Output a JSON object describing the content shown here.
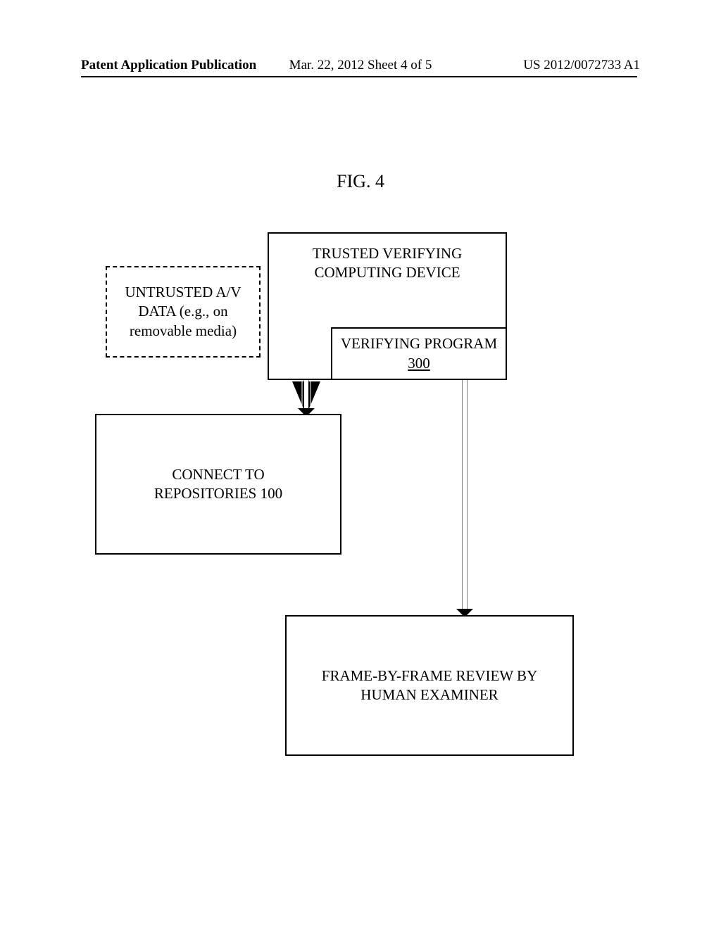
{
  "header": {
    "left": "Patent Application Publication",
    "center": "Mar. 22, 2012  Sheet 4 of 5",
    "right": "US 2012/0072733 A1"
  },
  "figure_label": "FIG. 4",
  "boxes": {
    "untrusted": {
      "line1": "UNTRUSTED A/V",
      "line2": "DATA (e.g., on",
      "line3": "removable media)"
    },
    "trusted": {
      "line1": "TRUSTED VERIFYING",
      "line2": "COMPUTING DEVICE"
    },
    "verifying_program": {
      "line1": "VERIFYING PROGRAM",
      "number": "300"
    },
    "connect": {
      "line1": "CONNECT TO",
      "line2": "REPOSITORIES 100"
    },
    "frame": {
      "line1": "FRAME-BY-FRAME REVIEW BY",
      "line2": "HUMAN EXAMINER"
    }
  }
}
